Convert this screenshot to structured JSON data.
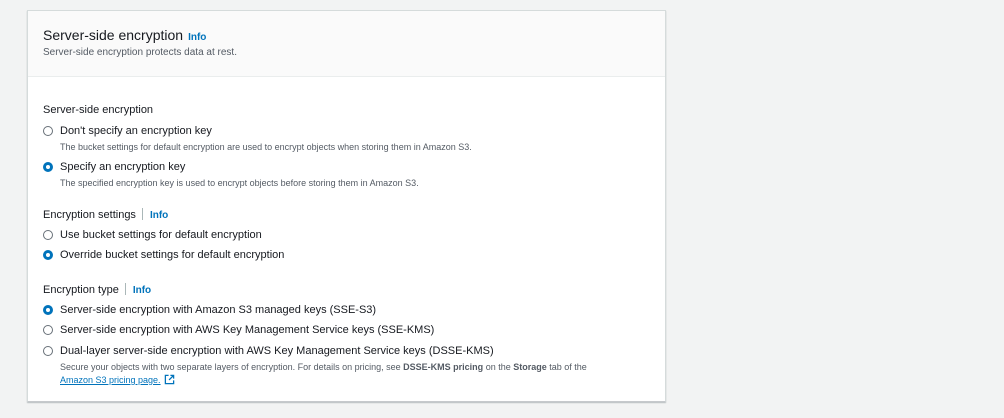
{
  "header": {
    "title": "Server-side encryption",
    "info": "Info",
    "description": "Server-side encryption protects data at rest."
  },
  "sse": {
    "label": "Server-side encryption",
    "options": [
      {
        "label": "Don't specify an encryption key",
        "description": "The bucket settings for default encryption are used to encrypt objects when storing them in Amazon S3.",
        "checked": false
      },
      {
        "label": "Specify an encryption key",
        "description": "The specified encryption key is used to encrypt objects before storing them in Amazon S3.",
        "checked": true
      }
    ]
  },
  "encryption_settings": {
    "label": "Encryption settings",
    "info": "Info",
    "options": [
      {
        "label": "Use bucket settings for default encryption",
        "checked": false
      },
      {
        "label": "Override bucket settings for default encryption",
        "checked": true
      }
    ]
  },
  "encryption_type": {
    "label": "Encryption type",
    "info": "Info",
    "options": [
      {
        "label": "Server-side encryption with Amazon S3 managed keys (SSE-S3)",
        "checked": true
      },
      {
        "label": "Server-side encryption with AWS Key Management Service keys (SSE-KMS)",
        "checked": false
      },
      {
        "label": "Dual-layer server-side encryption with AWS Key Management Service keys (DSSE-KMS)",
        "checked": false,
        "desc_part1": "Secure your objects with two separate layers of encryption. For details on pricing, see ",
        "desc_bold1": "DSSE-KMS pricing",
        "desc_part2": " on the ",
        "desc_bold2": "Storage",
        "desc_part3": " tab of the",
        "desc_link": "Amazon S3 pricing page."
      }
    ]
  },
  "colors": {
    "accent": "#0073bb",
    "panel_bg": "#ffffff",
    "header_bg": "#fafafa",
    "page_bg": "#f2f3f3"
  },
  "icons": {
    "external_link": "external-link-icon"
  }
}
